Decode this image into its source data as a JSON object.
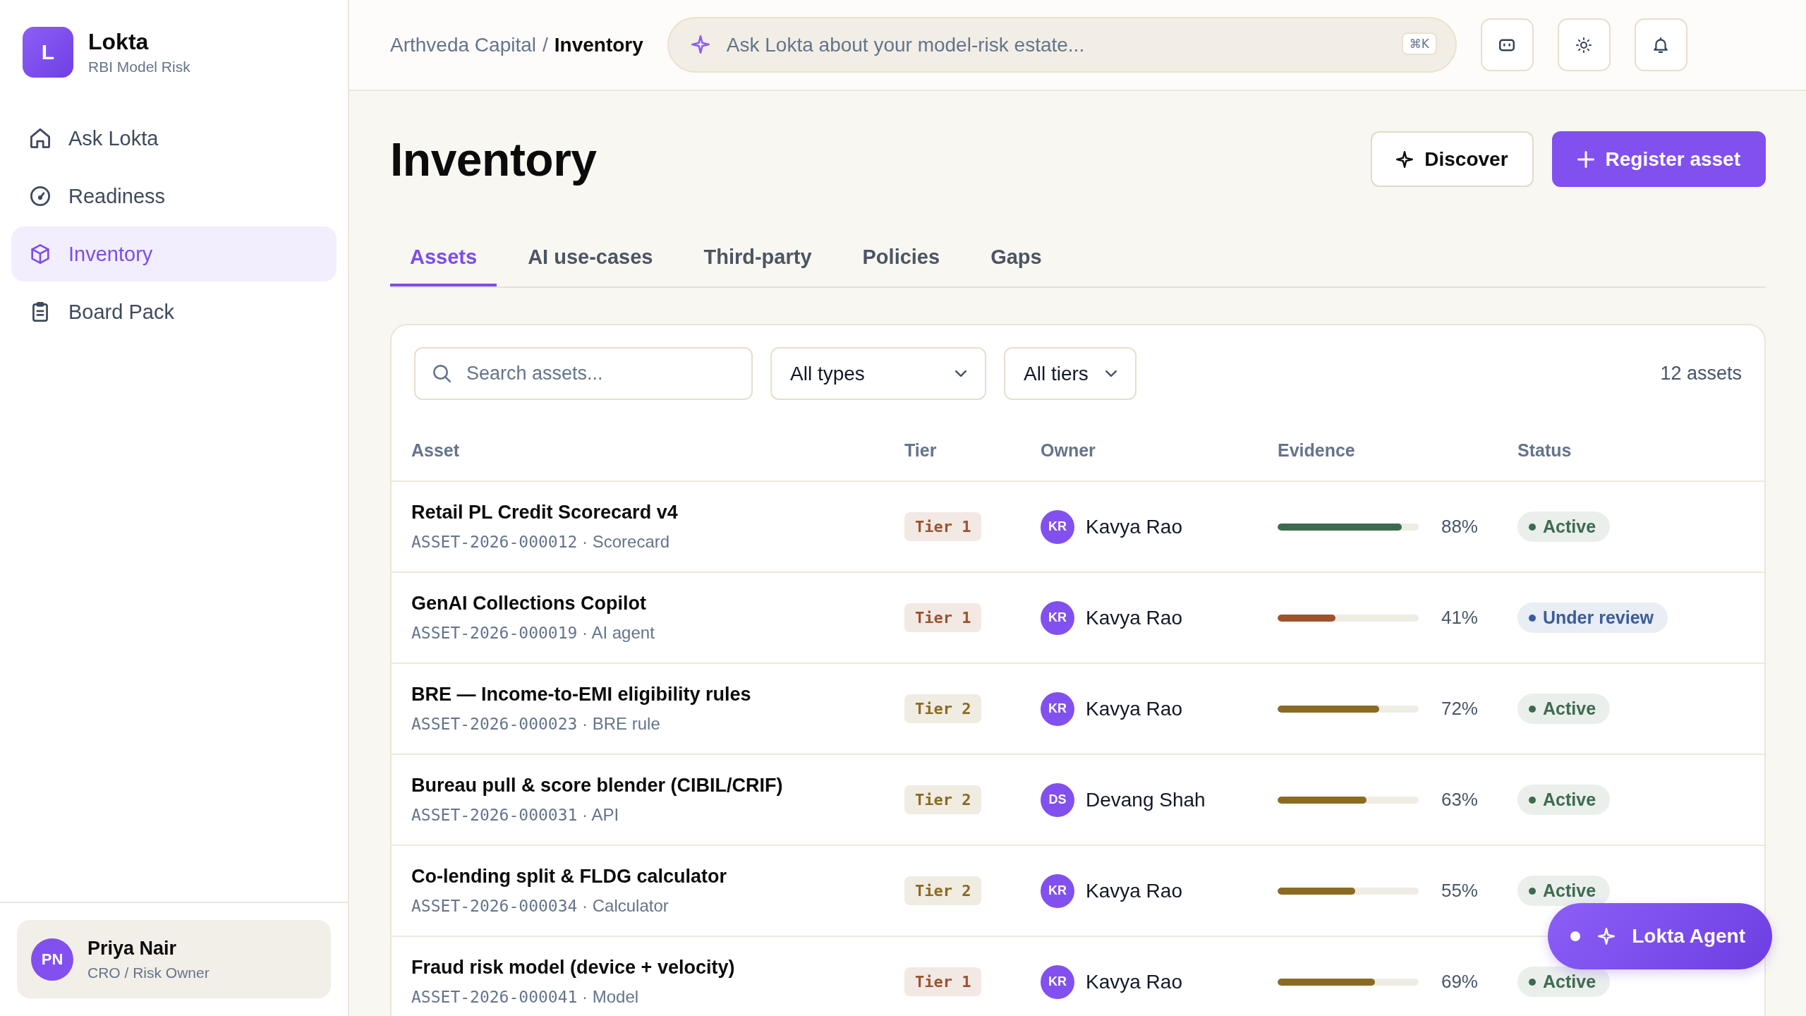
{
  "sidebar": {
    "brand": {
      "logo": "L",
      "name": "Lokta",
      "subtitle": "RBI Model Risk"
    },
    "nav": [
      {
        "label": "Ask Lokta",
        "selected": false
      },
      {
        "label": "Readiness",
        "selected": false
      },
      {
        "label": "Inventory",
        "selected": true
      },
      {
        "label": "Board Pack",
        "selected": false
      }
    ],
    "user": {
      "initials": "PN",
      "name": "Priya Nair",
      "role": "CRO / Risk Owner"
    }
  },
  "header": {
    "breadcrumb": {
      "parent": "Arthveda Capital",
      "separator": "/",
      "current": "Inventory"
    },
    "search": {
      "placeholder": "Ask Lokta about your model-risk estate...",
      "shortcut": "⌘K"
    }
  },
  "page": {
    "title": "Inventory",
    "actions": [
      {
        "label": "Discover",
        "kind": "secondary"
      },
      {
        "label": "Register asset",
        "kind": "primary"
      }
    ],
    "tabs": [
      {
        "label": "Assets",
        "selected": true
      },
      {
        "label": "AI use-cases",
        "selected": false
      },
      {
        "label": "Third-party",
        "selected": false
      },
      {
        "label": "Policies",
        "selected": false
      },
      {
        "label": "Gaps",
        "selected": false
      }
    ]
  },
  "filters": {
    "search": {
      "placeholder": "Search assets..."
    },
    "selects": [
      {
        "value": "All types"
      },
      {
        "value": "All tiers"
      }
    ],
    "count": "12 assets"
  },
  "table": {
    "columns": [
      "Asset",
      "Tier",
      "Owner",
      "Evidence",
      "Status"
    ],
    "rows": [
      {
        "name": "Retail PL Credit Scorecard v4",
        "id": "ASSET-2026-000012",
        "sep": "·",
        "type": "Scorecard",
        "tier": {
          "label": "Tier 1",
          "color": "#9b5230"
        },
        "owner": {
          "initials": "KR",
          "name": "Kavya Rao"
        },
        "evidence": {
          "level": 0.88,
          "reading": "88%",
          "color": "#3e6b50"
        },
        "status": {
          "label": "Active",
          "color": "#3e6b50"
        }
      },
      {
        "name": "GenAI Collections Copilot",
        "id": "ASSET-2026-000019",
        "sep": "·",
        "type": "AI agent",
        "tier": {
          "label": "Tier 1",
          "color": "#9b5230"
        },
        "owner": {
          "initials": "KR",
          "name": "Kavya Rao"
        },
        "evidence": {
          "level": 0.41,
          "reading": "41%",
          "color": "#a0522d"
        },
        "status": {
          "label": "Under review",
          "color": "#3b5c9c"
        }
      },
      {
        "name": "BRE — Income-to-EMI eligibility rules",
        "id": "ASSET-2026-000023",
        "sep": "·",
        "type": "BRE rule",
        "tier": {
          "label": "Tier 2",
          "color": "#8a6a22"
        },
        "owner": {
          "initials": "KR",
          "name": "Kavya Rao"
        },
        "evidence": {
          "level": 0.72,
          "reading": "72%",
          "color": "#8b6b22"
        },
        "status": {
          "label": "Active",
          "color": "#3e6b50"
        }
      },
      {
        "name": "Bureau pull & score blender (CIBIL/CRIF)",
        "id": "ASSET-2026-000031",
        "sep": "·",
        "type": "API",
        "tier": {
          "label": "Tier 2",
          "color": "#8a6a22"
        },
        "owner": {
          "initials": "DS",
          "name": "Devang Shah"
        },
        "evidence": {
          "level": 0.63,
          "reading": "63%",
          "color": "#8b6b22"
        },
        "status": {
          "label": "Active",
          "color": "#3e6b50"
        }
      },
      {
        "name": "Co-lending split & FLDG calculator",
        "id": "ASSET-2026-000034",
        "sep": "·",
        "type": "Calculator",
        "tier": {
          "label": "Tier 2",
          "color": "#8a6a22"
        },
        "owner": {
          "initials": "KR",
          "name": "Kavya Rao"
        },
        "evidence": {
          "level": 0.55,
          "reading": "55%",
          "color": "#8b6b22"
        },
        "status": {
          "label": "Active",
          "color": "#3e6b50"
        }
      },
      {
        "name": "Fraud risk model (device + velocity)",
        "id": "ASSET-2026-000041",
        "sep": "·",
        "type": "Model",
        "tier": {
          "label": "Tier 1",
          "color": "#9b5230"
        },
        "owner": {
          "initials": "KR",
          "name": "Kavya Rao"
        },
        "evidence": {
          "level": 0.69,
          "reading": "69%",
          "color": "#8b6b22"
        },
        "status": {
          "label": "Active",
          "color": "#3e6b50"
        }
      }
    ]
  },
  "agent": {
    "label": "Lokta Agent"
  }
}
